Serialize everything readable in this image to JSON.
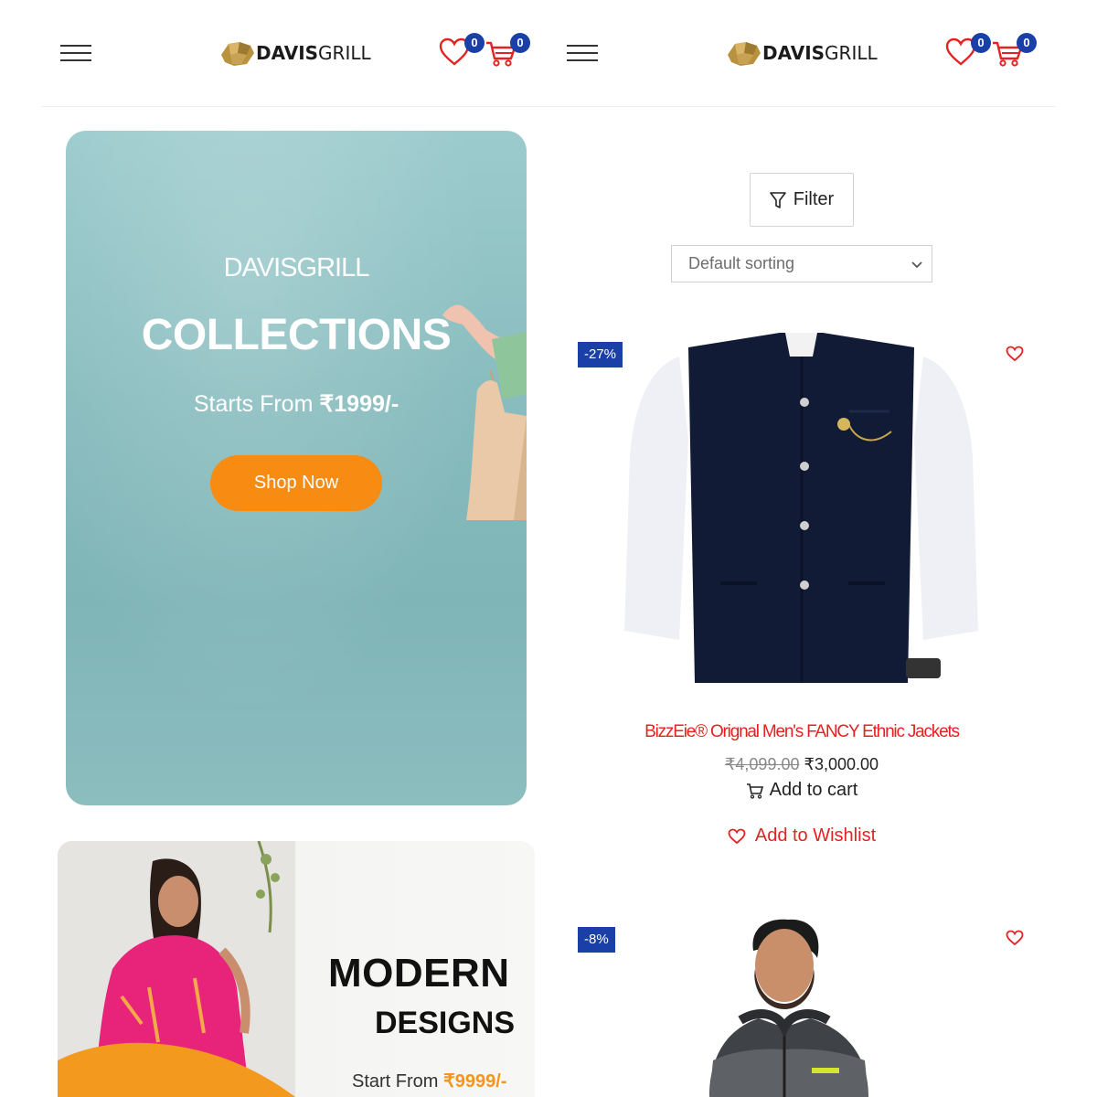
{
  "header": {
    "logo_bold": "DAVIS",
    "logo_light": "GRILL",
    "wishlist_count": "0",
    "cart_count": "0",
    "accent": "#1a3fa6"
  },
  "hero": {
    "brand": "DAVISGRILL",
    "title": "COLLECTIONS",
    "subtitle_prefix": "Starts From ",
    "subtitle_price": "₹1999/-",
    "button_label": "Shop Now",
    "button_color": "#f88b12"
  },
  "banner2": {
    "title_line1": "MODERN",
    "title_line2": "DESIGNS",
    "subtitle_prefix": "Start From ",
    "subtitle_price": "₹9999/-"
  },
  "shop": {
    "filter_label": "Filter",
    "sort_selected": "Default sorting"
  },
  "products": [
    {
      "discount": "-27%",
      "title": "BizzEie® Orignal Men's FANCY Ethnic Jackets",
      "old_price": "₹4,099.00",
      "price": "₹3,000.00",
      "cart_label": "Add to cart",
      "wishlist_label": "Add to Wishlist",
      "image_icon": "navy-ethnic-jacket-image"
    },
    {
      "discount": "-8%",
      "image_icon": "grey-hooded-jacket-image"
    }
  ],
  "icons": [
    "menu-icon",
    "heart-icon",
    "cart-icon",
    "filter-icon",
    "chevron-down-icon"
  ]
}
